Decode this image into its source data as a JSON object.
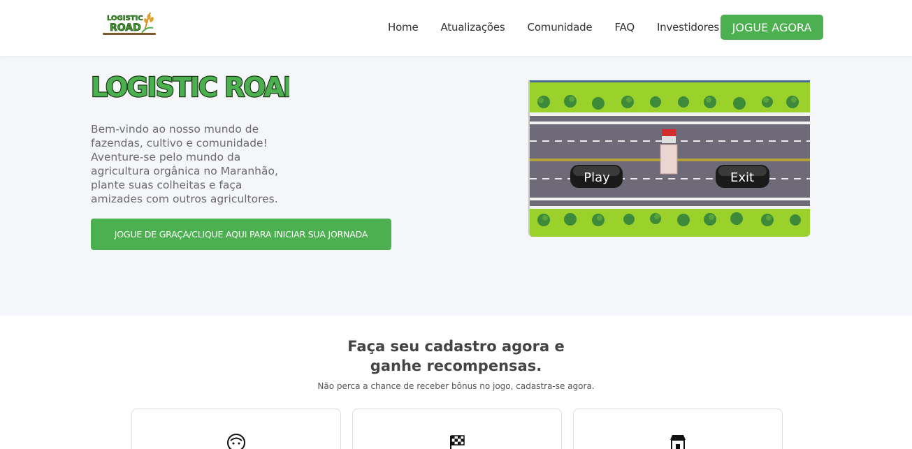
{
  "header": {
    "logo_text": "LOGISTIC ROAD",
    "nav": [
      {
        "label": "Home"
      },
      {
        "label": "Atualizações"
      },
      {
        "label": "Comunidade"
      },
      {
        "label": "FAQ"
      },
      {
        "label": "Investidores"
      }
    ],
    "cta_label": "JOGUE AGORA"
  },
  "hero": {
    "title": "LOGISTIC ROAD",
    "description": "Bem-vindo ao nosso mundo de fazendas, cultivo e comunidade! Aventure-se pelo mundo da agricultura orgânica no Maranhão, plante suas colheitas e faça amizades com outros agricultores.",
    "cta_label": "JOGUE DE GRAÇA/CLIQUE AQUI PARA INICIAR SUA JORNADA",
    "game": {
      "play_label": "Play",
      "exit_label": "Exit"
    }
  },
  "signup": {
    "title_line1": "Faça seu cadastro agora e",
    "title_line2": "ganhe recompensas.",
    "subtitle": "Não perca a chance de receber bônus no jogo, cadastra-se agora."
  },
  "cards": [
    {
      "icon": "face-icon"
    },
    {
      "icon": "checkered-flag-icon"
    },
    {
      "icon": "store-icon"
    }
  ],
  "colors": {
    "accent": "#4caf50",
    "hero_bg": "#f5f6f9",
    "grass": "#9ad12b",
    "road": "#6e6a78"
  }
}
